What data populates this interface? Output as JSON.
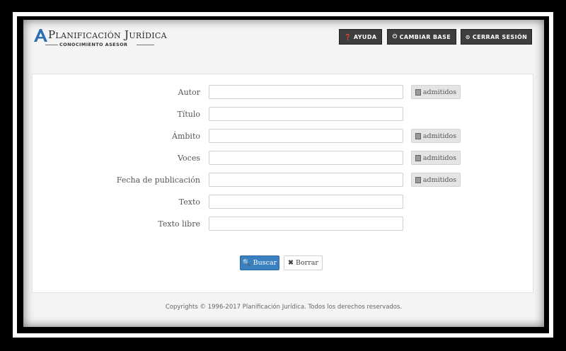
{
  "brand": {
    "title": "Planificación Jurídica",
    "subtitle": "CONOCIMIENTO ASESOR",
    "mark_color": "#2b6fb0"
  },
  "header": {
    "help_label": "AYUDA",
    "change_base_label": "CAMBIAR BASE",
    "logout_label": "CERRAR SESIÓN"
  },
  "form": {
    "fields": [
      {
        "label": "Autor",
        "value": "",
        "admitidos": true
      },
      {
        "label": "Título",
        "value": "",
        "admitidos": false
      },
      {
        "label": "Ámbito",
        "value": "",
        "admitidos": true
      },
      {
        "label": "Voces",
        "value": "",
        "admitidos": true
      },
      {
        "label": "Fecha de publicación",
        "value": "",
        "admitidos": true
      },
      {
        "label": "Texto",
        "value": "",
        "admitidos": false
      },
      {
        "label": "Texto libre",
        "value": "",
        "admitidos": false
      }
    ],
    "admitidos_label": "admitidos",
    "search_label": "Buscar",
    "clear_label": "Borrar"
  },
  "footer": {
    "copyright": "Copyrights © 1996-2017 Planificación Jurídica. Todos los derechos reservados."
  },
  "colors": {
    "primary_button": "#3a7fc0",
    "header_button": "#3e3e3e"
  },
  "icons": {
    "help": "question-circle-icon",
    "change_base": "power-icon",
    "logout": "sign-out-icon",
    "admitidos": "list-icon",
    "search": "magnifier-icon",
    "clear": "x-icon"
  }
}
